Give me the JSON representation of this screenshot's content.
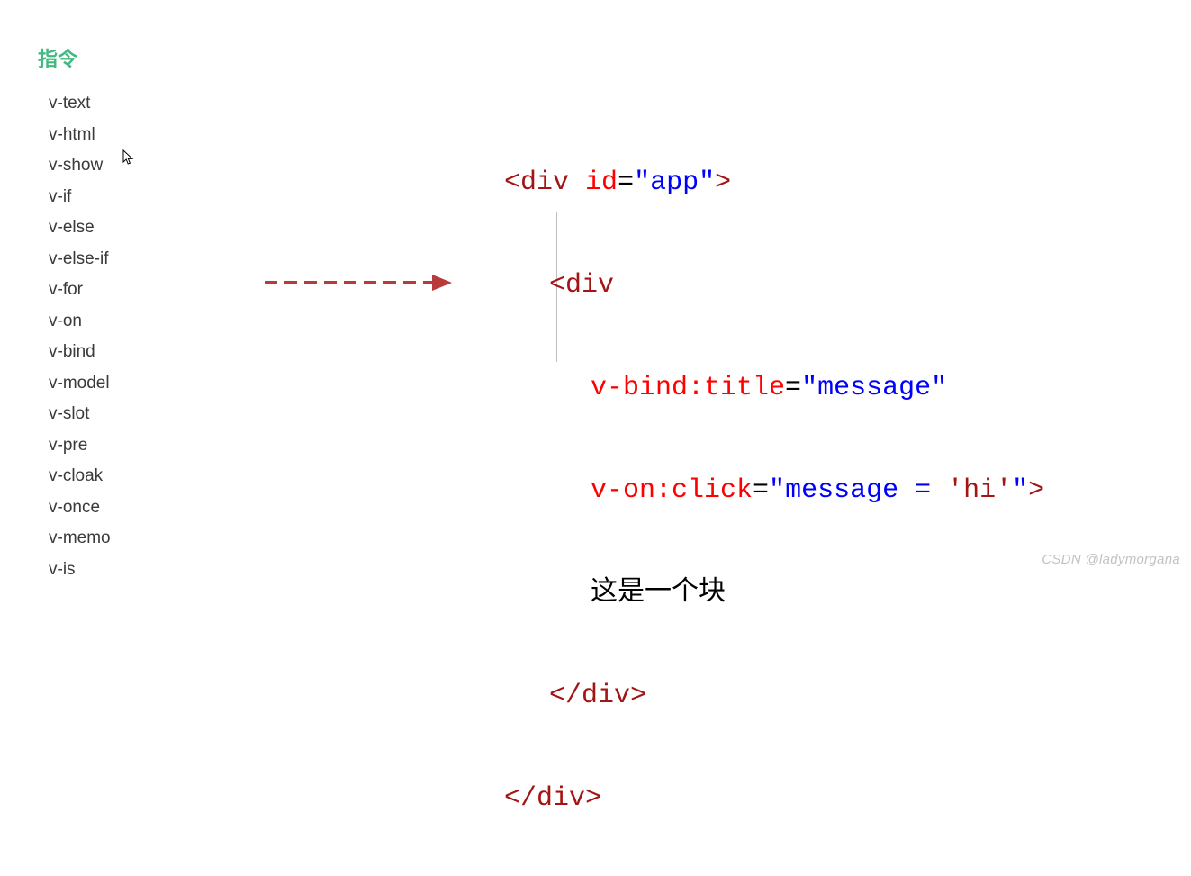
{
  "sidebar": {
    "title": "指令",
    "items": [
      "v-text",
      "v-html",
      "v-show",
      "v-if",
      "v-else",
      "v-else-if",
      "v-for",
      "v-on",
      "v-bind",
      "v-model",
      "v-slot",
      "v-pre",
      "v-cloak",
      "v-once",
      "v-memo",
      "v-is"
    ]
  },
  "code": {
    "line1": {
      "open": "<",
      "tag": "div",
      "sp": " ",
      "attr": "id",
      "eq": "=",
      "val": "\"app\"",
      "close": ">"
    },
    "line2": {
      "open": "<",
      "tag": "div"
    },
    "line3": {
      "attr": "v-bind:title",
      "eq": "=",
      "val": "\"message\""
    },
    "line4": {
      "attr": "v-on:click",
      "eq": "=",
      "q1": "\"",
      "body": "message = ",
      "lit": "'hi'",
      "q2": "\"",
      "close": ">"
    },
    "line5": {
      "text": "这是一个块"
    },
    "line6": {
      "open": "</",
      "tag": "div",
      "close": ">"
    },
    "line7": {
      "open": "</",
      "tag": "div",
      "close": ">"
    }
  },
  "watermark": "CSDN @ladymorgana"
}
